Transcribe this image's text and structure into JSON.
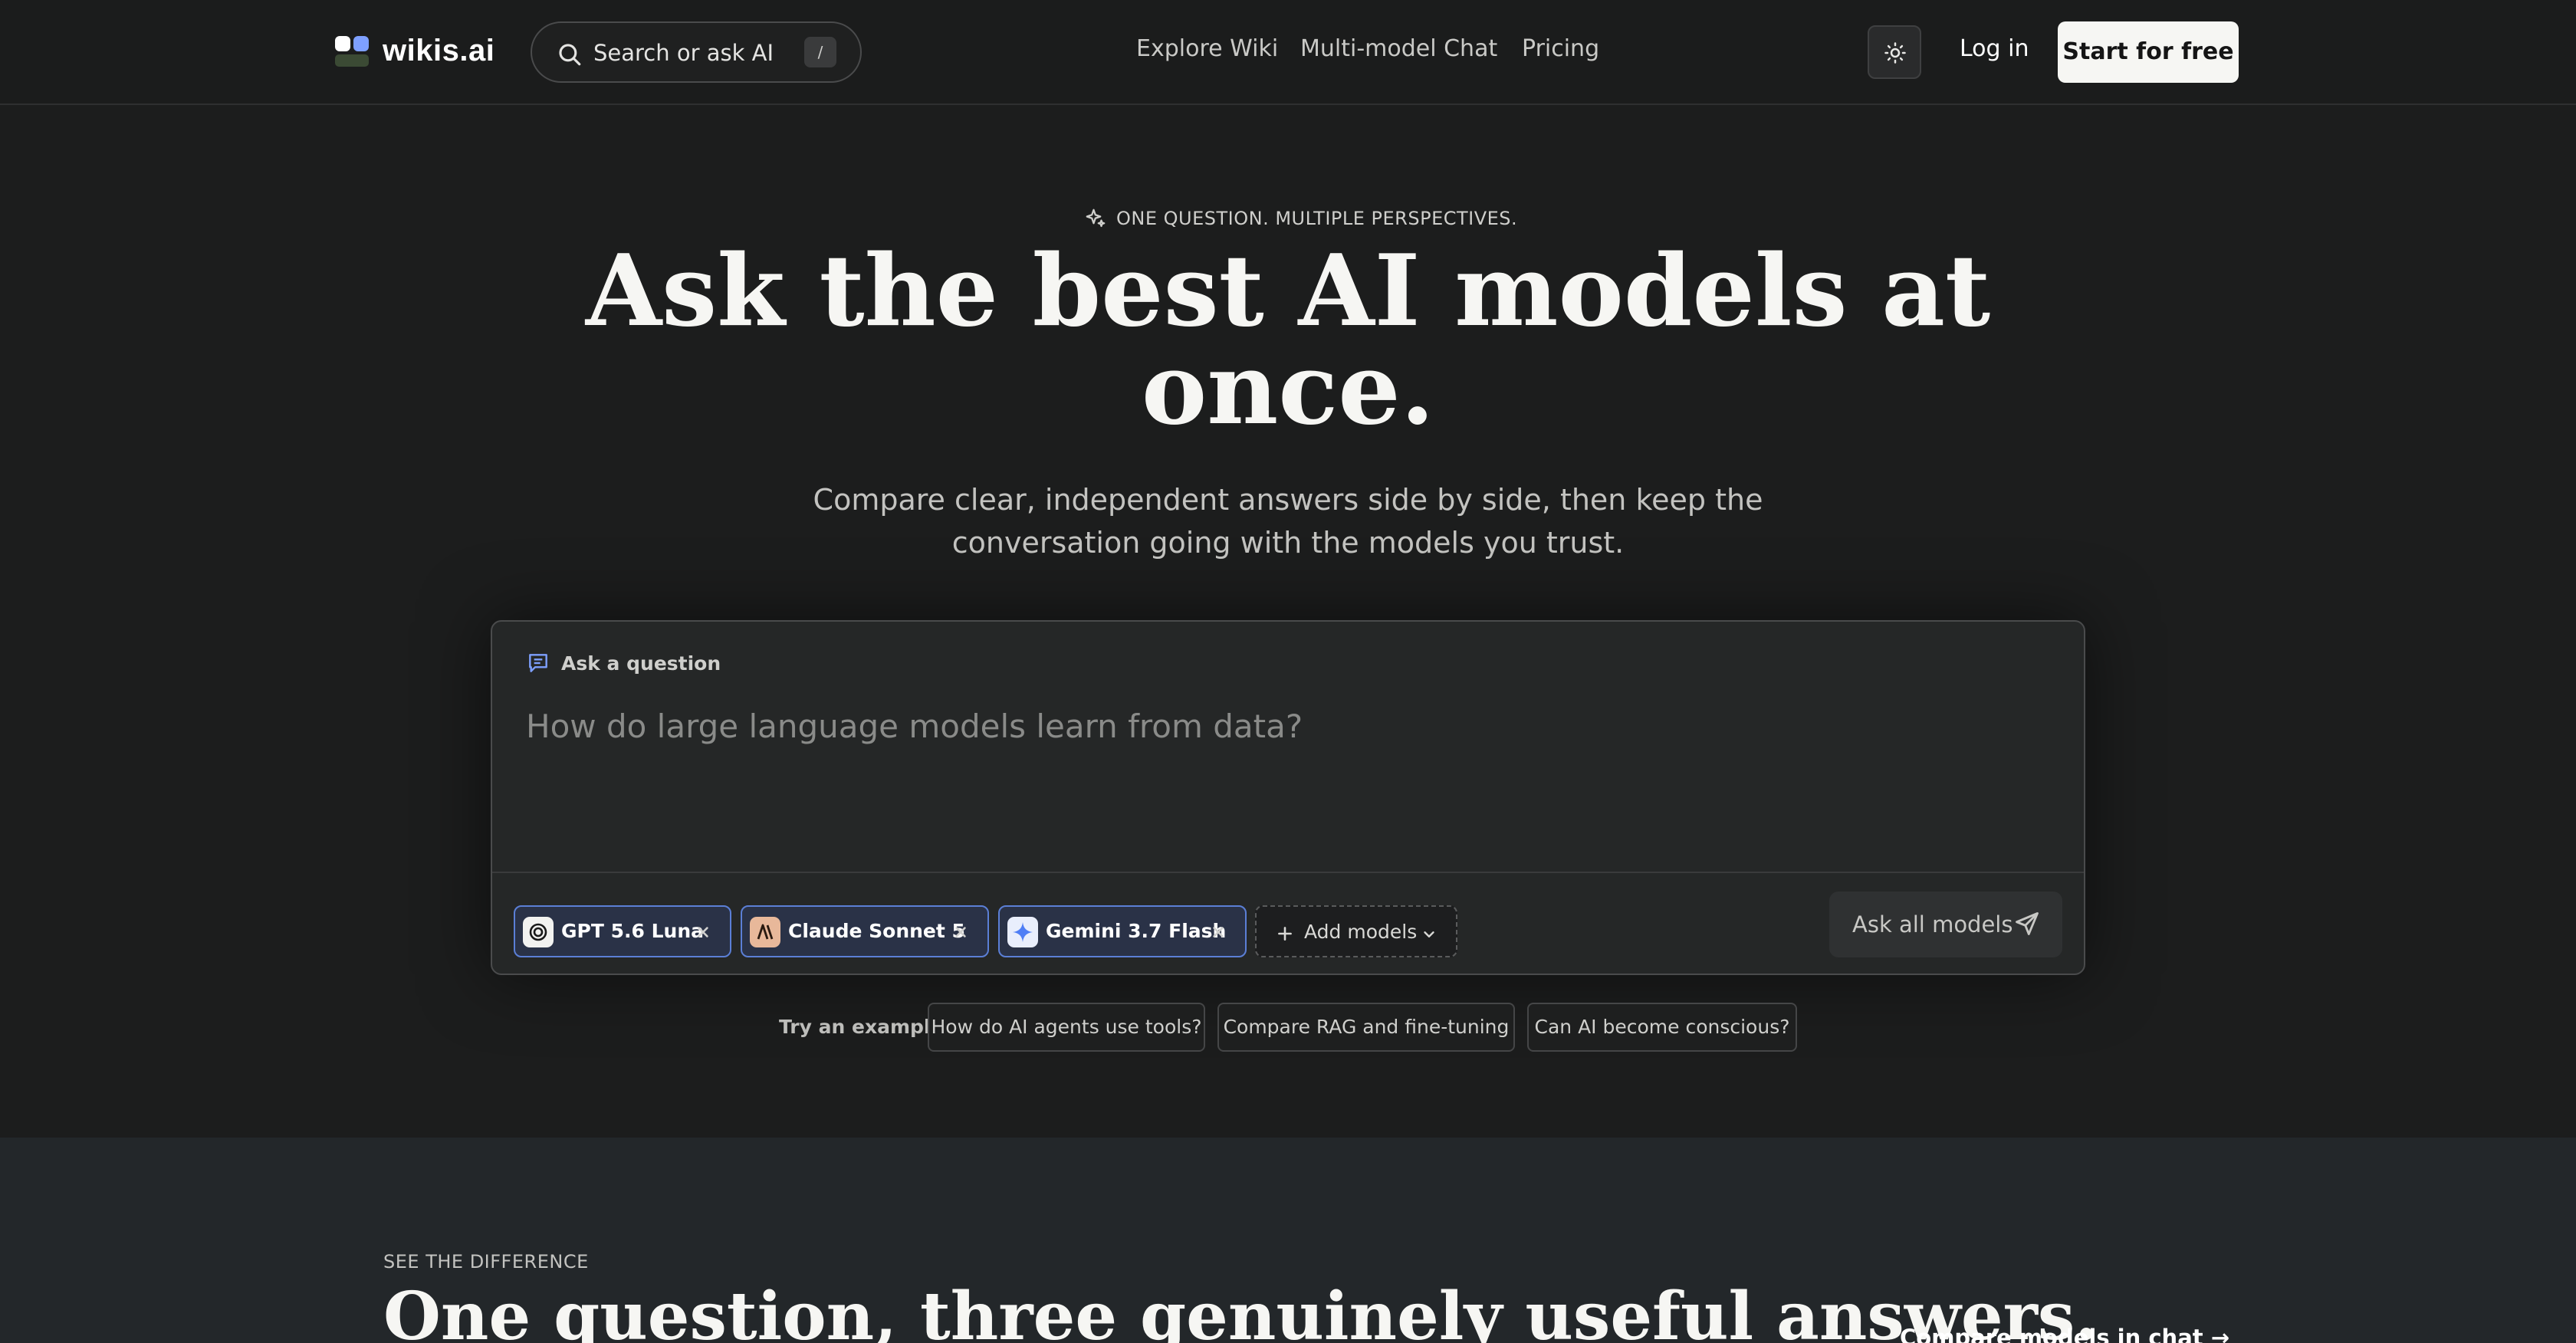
{
  "header": {
    "logo_text": "wikis.ai",
    "search_placeholder": "Search or ask AI",
    "search_shortcut": "/",
    "nav": [
      "Explore Wiki",
      "Multi-model Chat",
      "Pricing"
    ],
    "theme_icon": "sun-icon",
    "login_label": "Log in",
    "cta_label": "Start for free"
  },
  "hero": {
    "eyebrow": "ONE QUESTION. MULTIPLE PERSPECTIVES.",
    "title": "Ask the best AI models at once.",
    "subtitle": "Compare clear, independent answers side by side, then keep the conversation going with the models you trust."
  },
  "composer": {
    "label": "Ask a question",
    "placeholder": "How do large language models learn from data?",
    "models": [
      {
        "label": "GPT 5.6 Luna",
        "icon": "openai-icon"
      },
      {
        "label": "Claude Sonnet 5",
        "icon": "anthropic-icon"
      },
      {
        "label": "Gemini 3.7 Flash",
        "icon": "gemini-icon"
      }
    ],
    "add_models_label": "Add models",
    "ask_label": "Ask all models"
  },
  "examples": {
    "label": "Try an example",
    "items": [
      "How do AI agents use tools?",
      "Compare RAG and fine-tuning",
      "Can AI become conscious?"
    ]
  },
  "section2": {
    "eyebrow": "SEE THE DIFFERENCE",
    "title": "One question, three genuinely useful answers.",
    "link": "Compare models in chat"
  },
  "colors": {
    "background": "#1c1d1d",
    "chip_border": "#5b7fd6",
    "cta_background": "#f6f6f3",
    "section2_background": "#23272a"
  }
}
